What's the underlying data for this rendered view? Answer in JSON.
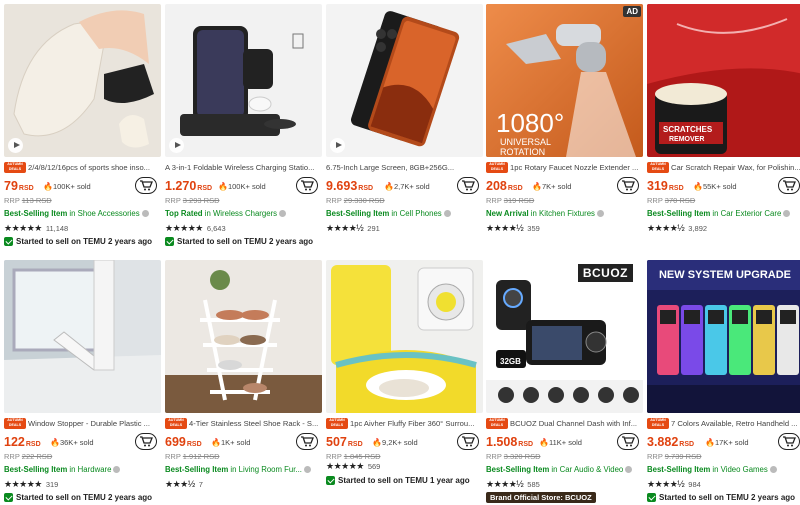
{
  "products": [
    {
      "title": "2/4/8/12/16pcs of sports shoe inso...",
      "price": "79",
      "currency": "RSD",
      "sold": "100K+ sold",
      "rrp": "113 RSD",
      "tag_prefix": "Best-Selling Item",
      "tag_rest": " in Shoe Accessories",
      "tag_color": "#0a8a1f",
      "stars": "★★★★★",
      "rating_count": "11,148",
      "started": "Started to sell on TEMU 2 years ago",
      "badge": [
        "AUTUMN",
        "DEALS"
      ]
    },
    {
      "title": "A 3-in-1 Foldable Wireless Charging Statio...",
      "price": "1.270",
      "currency": "RSD",
      "sold": "100K+ sold",
      "rrp": "3.293 RSD",
      "tag_prefix": "Top Rated",
      "tag_rest": " in Wireless Chargers",
      "tag_color": "#0a8a1f",
      "stars": "★★★★★",
      "rating_count": "6,643",
      "started": "Started to sell on TEMU 2 years ago",
      "badge": null
    },
    {
      "title": "6.75-Inch Large Screen, 8GB+256G...",
      "price": "9.693",
      "currency": "RSD",
      "sold": "2,7K+ sold",
      "rrp": "29.330 RSD",
      "tag_prefix": "Best-Selling Item",
      "tag_rest": " in Cell Phones",
      "tag_color": "#0a8a1f",
      "stars": "★★★★½",
      "rating_count": "291",
      "started": "",
      "badge": null
    },
    {
      "title": "1pc Rotary Faucet Nozzle Extender ...",
      "price": "208",
      "currency": "RSD",
      "sold": "7K+ sold",
      "rrp": "319 RSD",
      "tag_prefix": "New Arrival",
      "tag_rest": " in Kitchen Fixtures",
      "tag_color": "#0a8a1f",
      "stars": "★★★★½",
      "rating_count": "359",
      "started": "",
      "badge": [
        "AUTUMN",
        "DEALS"
      ],
      "ad": "AD"
    },
    {
      "title": "Car Scratch Repair Wax, for Polishin...",
      "price": "319",
      "currency": "RSD",
      "sold": "55K+ sold",
      "rrp": "370 RSD",
      "tag_prefix": "Best-Selling Item",
      "tag_rest": " in Car Exterior Care",
      "tag_color": "#0a8a1f",
      "stars": "★★★★½",
      "rating_count": "3,892",
      "started": "",
      "badge": [
        "AUTUMN",
        "DEALS"
      ]
    },
    {
      "title": "Window Stopper - Durable Plastic ...",
      "price": "122",
      "currency": "RSD",
      "sold": "36K+ sold",
      "rrp": "222 RSD",
      "tag_prefix": "Best-Selling Item",
      "tag_rest": " in Hardware",
      "tag_color": "#0a8a1f",
      "stars": "★★★★★",
      "rating_count": "319",
      "started": "Started to sell on TEMU 2 years ago",
      "badge": [
        "AUTUMN",
        "DEALS"
      ]
    },
    {
      "title": "4-Tier Stainless Steel Shoe Rack - S...",
      "price": "699",
      "currency": "RSD",
      "sold": "1K+ sold",
      "rrp": "1.912 RSD",
      "tag_prefix": "Best-Selling Item",
      "tag_rest": " in Living Room Fur...",
      "tag_color": "#0a8a1f",
      "stars": "★★★½",
      "rating_count": "7",
      "started": "",
      "badge": [
        "AUTUMN",
        "DEALS"
      ]
    },
    {
      "title": "1pc Aivher Fluffy Fiber 360° Surrou...",
      "price": "507",
      "currency": "RSD",
      "sold": "9,2K+ sold",
      "rrp": "1.845 RSD",
      "tag_prefix": "",
      "tag_rest": "",
      "tag_color": "#0a8a1f",
      "stars": "★★★★★",
      "rating_count": "569",
      "started": "Started to sell on TEMU 1 year ago",
      "badge": [
        "AUTUMN",
        "DEALS"
      ]
    },
    {
      "title": "BCUOZ Dual Channel Dash with Inf...",
      "price": "1.508",
      "currency": "RSD",
      "sold": "11K+ sold",
      "rrp": "3.320 RSD",
      "tag_prefix": "Best-Selling Item",
      "tag_rest": " in Car Audio & Video",
      "tag_color": "#0a8a1f",
      "stars": "★★★★½",
      "rating_count": "585",
      "started": "",
      "badge": [
        "AUTUMN",
        "DEALS"
      ],
      "brand_store": "Brand Official Store: BCUOZ",
      "brand": "BCUOZ"
    },
    {
      "title": "7 Colors Available, Retro Handheld ...",
      "price": "3.882",
      "currency": "RSD",
      "sold": "17K+ sold",
      "rrp": "9.739 RSD",
      "tag_prefix": "Best-Selling Item",
      "tag_rest": " in Video Games",
      "tag_color": "#0a8a1f",
      "stars": "★★★★½",
      "rating_count": "984",
      "started": "Started to sell on TEMU 2 years ago",
      "badge": [
        "AUTUMN",
        "DEALS"
      ],
      "banner": "NEW SYSTEM UPGRADE"
    }
  ],
  "image_text": {
    "faucet_big": "1080°",
    "faucet_small": "UNIVERSAL",
    "faucet_small2": "ROTATION",
    "wax_label1": "SCRATCHES",
    "wax_label2": "REMOVER",
    "dashcam_storage": "32GB"
  },
  "colors": {
    "price": "#e0420f",
    "badge": "#e54a13",
    "green": "#0a8a1f"
  }
}
